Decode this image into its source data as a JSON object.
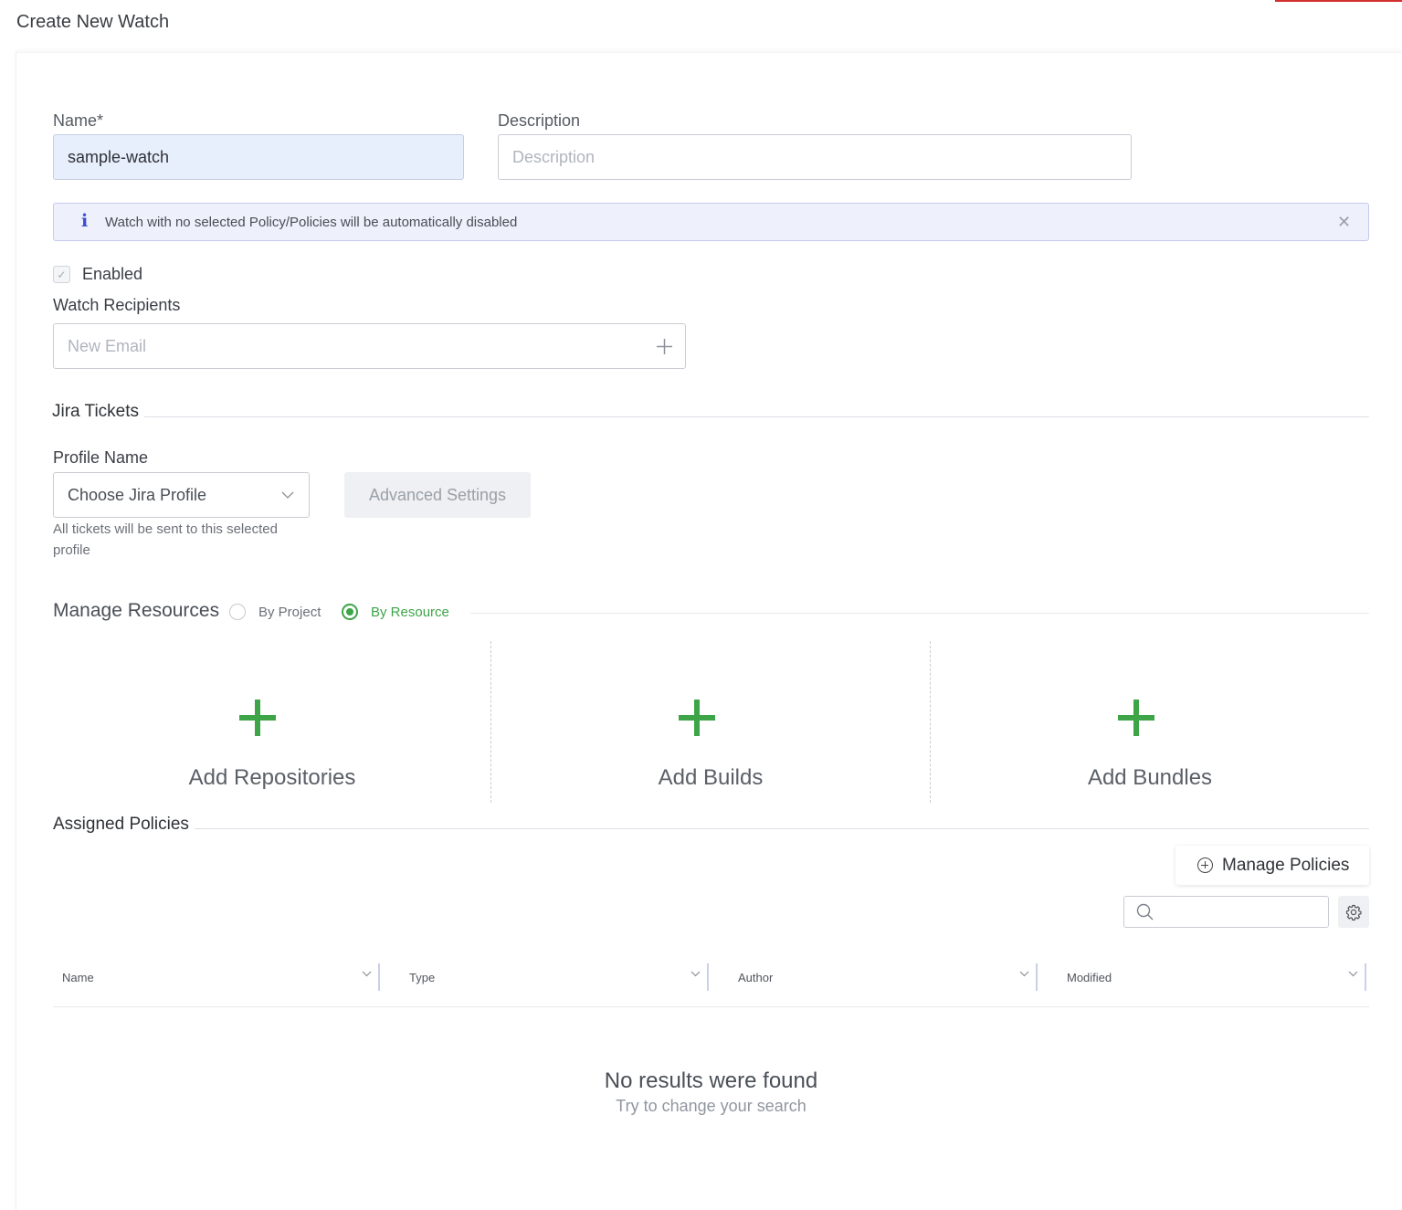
{
  "page": {
    "title": "Create New Watch"
  },
  "form": {
    "name_label": "Name*",
    "name_value": "sample-watch",
    "description_label": "Description",
    "description_placeholder": "Description",
    "info_message": "Watch with no selected Policy/Policies will be automatically disabled",
    "enabled_label": "Enabled",
    "enabled_checked": true,
    "recipients_label": "Watch Recipients",
    "recipients_placeholder": "New Email"
  },
  "jira": {
    "section_title": "Jira Tickets",
    "profile_label": "Profile Name",
    "profile_placeholder": "Choose Jira Profile",
    "advanced_button": "Advanced Settings",
    "helper_text": "All tickets will be sent to this selected profile"
  },
  "resources": {
    "section_title": "Manage Resources",
    "options": [
      {
        "label": "By Project",
        "selected": false
      },
      {
        "label": "By Resource",
        "selected": true
      }
    ],
    "cards": [
      {
        "label": "Add Repositories"
      },
      {
        "label": "Add Builds"
      },
      {
        "label": "Add Bundles"
      }
    ]
  },
  "policies": {
    "section_title": "Assigned Policies",
    "manage_button": "Manage Policies",
    "search_value": "",
    "columns": [
      "Name",
      "Type",
      "Author",
      "Modified"
    ],
    "empty_title": "No results were found",
    "empty_subtitle": "Try to change your search"
  },
  "colors": {
    "accent_green": "#3da548",
    "info_blue": "#3c4fd0",
    "top_accent": "#d32f2f"
  }
}
